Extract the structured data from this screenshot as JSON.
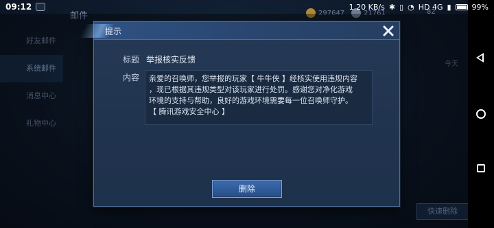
{
  "status_bar": {
    "time": "09:12",
    "network_speed": "1.20 KB/s",
    "network_type": "HD 4G",
    "battery": "99%"
  },
  "background": {
    "header_title": "邮件",
    "resource_1": "297647",
    "resource_2": "21761",
    "resource_3": "82",
    "sidebar_items": [
      "好友邮件",
      "系统邮件",
      "消息中心",
      "礼物中心"
    ],
    "active_sidebar_index": 1,
    "today_label": "今天",
    "quick_delete_label": "快速删除"
  },
  "dialog": {
    "title": "提示",
    "subject_label": "标题",
    "subject_value": "举报核实反馈",
    "content_label": "内容",
    "content_lines": [
      "亲爱的召唤师，您举报的玩家【 牛牛侠 】经核实使用违规内容",
      "，现已根据其违规类型对该玩家进行处罚。感谢您对净化游戏",
      "环境的支持与帮助，良好的游戏环境需要每一位召唤师守护。",
      "【 腾讯游戏安全中心 】"
    ],
    "delete_label": "删除"
  },
  "icons": {
    "close": "close-icon",
    "back": "back-icon",
    "home": "home-icon",
    "recent": "recent-apps-icon"
  },
  "colors": {
    "dialog_bg": "#22364f",
    "button_blue": "#2f5a99",
    "nav_bar": "#000000"
  }
}
